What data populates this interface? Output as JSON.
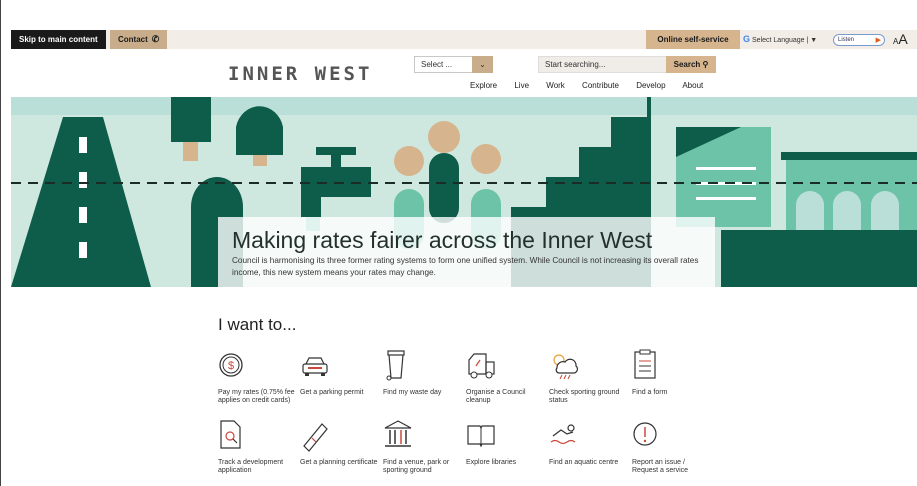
{
  "utility": {
    "skip_label": "Skip to main content",
    "contact_label": "Contact",
    "online_self_service": "Online self-service",
    "select_language": "Select Language | ▼",
    "listen_label": "Listen",
    "font_size_label": "A"
  },
  "header": {
    "logo_text": "INNER WEST",
    "select_placeholder": "Select ...",
    "search_placeholder": "Start searching...",
    "search_button": "Search",
    "nav": [
      "Explore",
      "Live",
      "Work",
      "Contribute",
      "Develop",
      "About"
    ]
  },
  "hero": {
    "title": "Making rates fairer across the Inner West",
    "subtitle": "Council is harmonising its three former rating systems to form one unified system. While Council is not increasing its overall rates income, this new system means your rates may change."
  },
  "want_to": {
    "heading": "I want to...",
    "items": [
      {
        "label": "Pay my rates (0.75% fee applies on credit cards)",
        "icon": "dollar-icon"
      },
      {
        "label": "Get a parking permit",
        "icon": "car-icon"
      },
      {
        "label": "Find my waste day",
        "icon": "bin-icon"
      },
      {
        "label": "Organise a Council cleanup",
        "icon": "truck-icon"
      },
      {
        "label": "Check sporting ground status",
        "icon": "weather-icon"
      },
      {
        "label": "Find a form",
        "icon": "clipboard-icon"
      },
      {
        "label": "Track a development application",
        "icon": "document-search-icon"
      },
      {
        "label": "Get a planning certificate",
        "icon": "certificate-icon"
      },
      {
        "label": "Find a venue, park or sporting ground",
        "icon": "venue-icon"
      },
      {
        "label": "Explore libraries",
        "icon": "book-icon"
      },
      {
        "label": "Find an aquatic centre",
        "icon": "swimmer-icon"
      },
      {
        "label": "Report an issue / Request a service",
        "icon": "alert-icon"
      }
    ]
  },
  "colors": {
    "dark_green": "#0e5c4a",
    "mint": "#6cc3a8",
    "tan": "#d6b48e",
    "hero_bg": "#cfe8df"
  }
}
